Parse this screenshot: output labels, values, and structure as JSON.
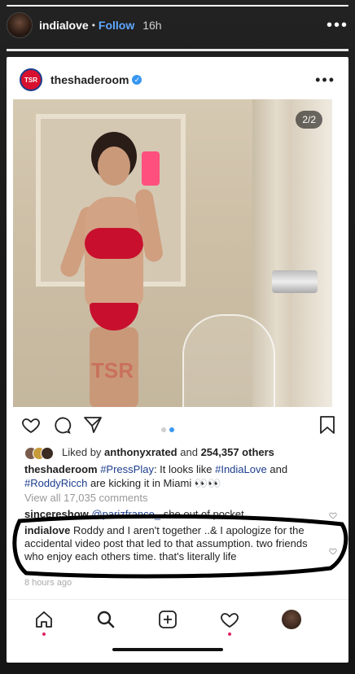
{
  "story": {
    "username": "indialove",
    "separator": "•",
    "follow_label": "Follow",
    "time": "16h",
    "more": "•••",
    "progress_fraction": 1
  },
  "post": {
    "username": "theshaderoom",
    "logo_text": "TSR",
    "more": "•••",
    "page_indicator": "2/2",
    "watermark": "TSR",
    "carousel_dots": 2,
    "carousel_active": 2,
    "likes_prefix": "Liked by",
    "likes_user": "anthonyxrated",
    "likes_mid": "and",
    "likes_count": "254,357 others",
    "caption_user": "theshaderoom",
    "caption_tag1": "#PressPlay",
    "caption_text1": ": It looks like",
    "caption_tag2": "#IndiaLove",
    "caption_text2": "and",
    "caption_tag3": "#RoddyRicch",
    "caption_text3": "are kicking it in Miami 👀👀",
    "view_all": "View all 17,035 comments",
    "comments": [
      {
        "user": "sincereshow",
        "mention": "@parizfrance_",
        "text": "she out of pocket."
      },
      {
        "user": "indialove",
        "text": "Roddy and I aren't together ..& I apologize for the accidental video post that led to that assumption. two friends who enjoy each others time. that's literally life"
      }
    ],
    "time_ago": "8 hours ago"
  },
  "colors": {
    "accent": "#3897f0",
    "link": "#1c3d8c",
    "tsr_red": "#d8102f",
    "notification": "#e0245e"
  }
}
